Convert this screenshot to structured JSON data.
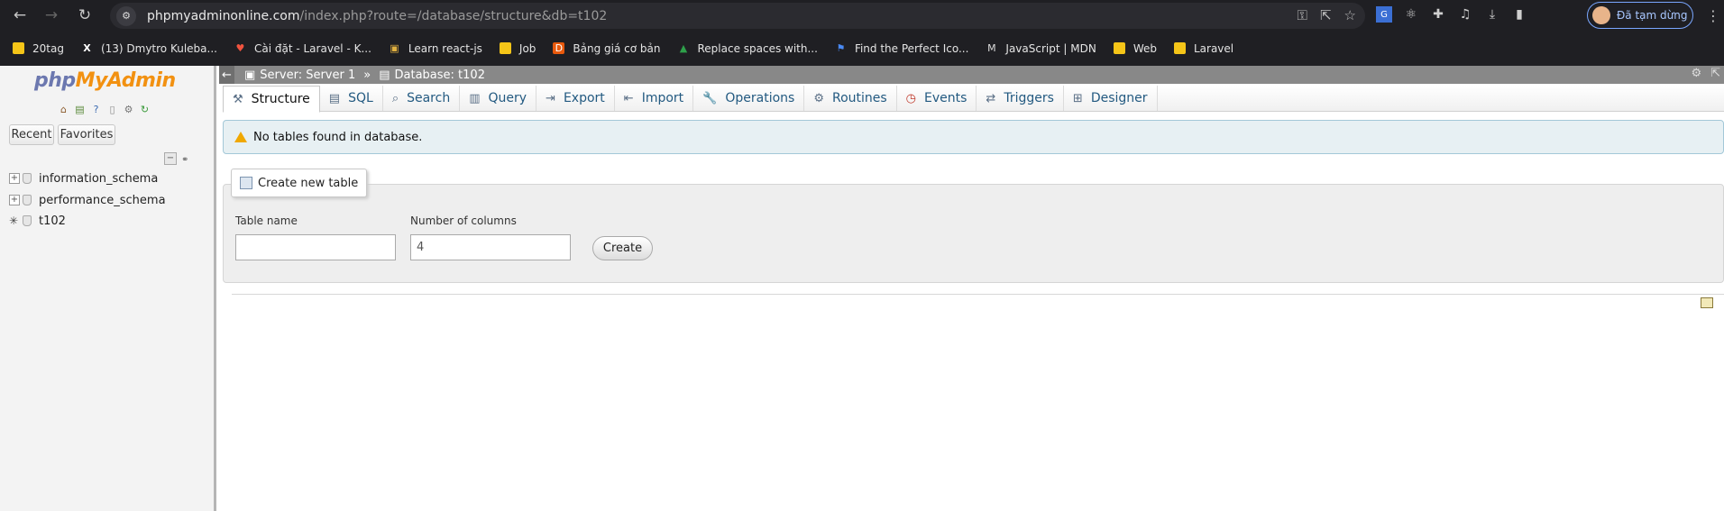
{
  "browser": {
    "url_host": "phpmyadminonline.com",
    "url_path": "/index.php?route=/database/structure&db=t102",
    "profile_label": "Đã tạm dừng",
    "bookmarks": [
      {
        "label": "20tag",
        "icon": "folder-icon"
      },
      {
        "label": "(13) Dmytro Kuleba...",
        "icon": "x-icon"
      },
      {
        "label": "Cài đặt - Laravel - K...",
        "icon": "laravel-icon"
      },
      {
        "label": "Learn react-js",
        "icon": "page-icon"
      },
      {
        "label": "Job",
        "icon": "folder-icon"
      },
      {
        "label": "Bảng giá cơ bản",
        "icon": "d-icon"
      },
      {
        "label": "Replace spaces with...",
        "icon": "arrow-icon"
      },
      {
        "label": "Find the Perfect Ico...",
        "icon": "flag-icon"
      },
      {
        "label": "JavaScript | MDN",
        "icon": "mdn-icon"
      },
      {
        "label": "Web",
        "icon": "folder-icon"
      },
      {
        "label": "Laravel",
        "icon": "folder-icon"
      }
    ]
  },
  "sidebar": {
    "logo_php": "php",
    "logo_rest": "MyAdmin",
    "recent_label": "Recent",
    "favorites_label": "Favorites",
    "databases": [
      {
        "name": "information_schema"
      },
      {
        "name": "performance_schema"
      },
      {
        "name": "t102"
      }
    ]
  },
  "breadcrumb": {
    "server": "Server: Server 1",
    "separator": "»",
    "database": "Database: t102"
  },
  "tabs": [
    {
      "label": "Structure",
      "icon": "structure-icon",
      "active": true
    },
    {
      "label": "SQL",
      "icon": "sql-icon"
    },
    {
      "label": "Search",
      "icon": "search-icon"
    },
    {
      "label": "Query",
      "icon": "query-icon"
    },
    {
      "label": "Export",
      "icon": "export-icon"
    },
    {
      "label": "Import",
      "icon": "import-icon"
    },
    {
      "label": "Operations",
      "icon": "wrench-icon"
    },
    {
      "label": "Routines",
      "icon": "routines-icon"
    },
    {
      "label": "Events",
      "icon": "clock-icon"
    },
    {
      "label": "Triggers",
      "icon": "triggers-icon"
    },
    {
      "label": "Designer",
      "icon": "designer-icon"
    }
  ],
  "notice": {
    "text": "No tables found in database."
  },
  "create_table": {
    "legend": "Create new table",
    "table_name_label": "Table name",
    "table_name_value": "",
    "columns_label": "Number of columns",
    "columns_value": "4",
    "create_label": "Create"
  },
  "colors": {
    "tab_link": "#235a81",
    "notice_bg": "#e7f0f3",
    "logo_php": "#6c78af",
    "logo_rest": "#f29111"
  }
}
